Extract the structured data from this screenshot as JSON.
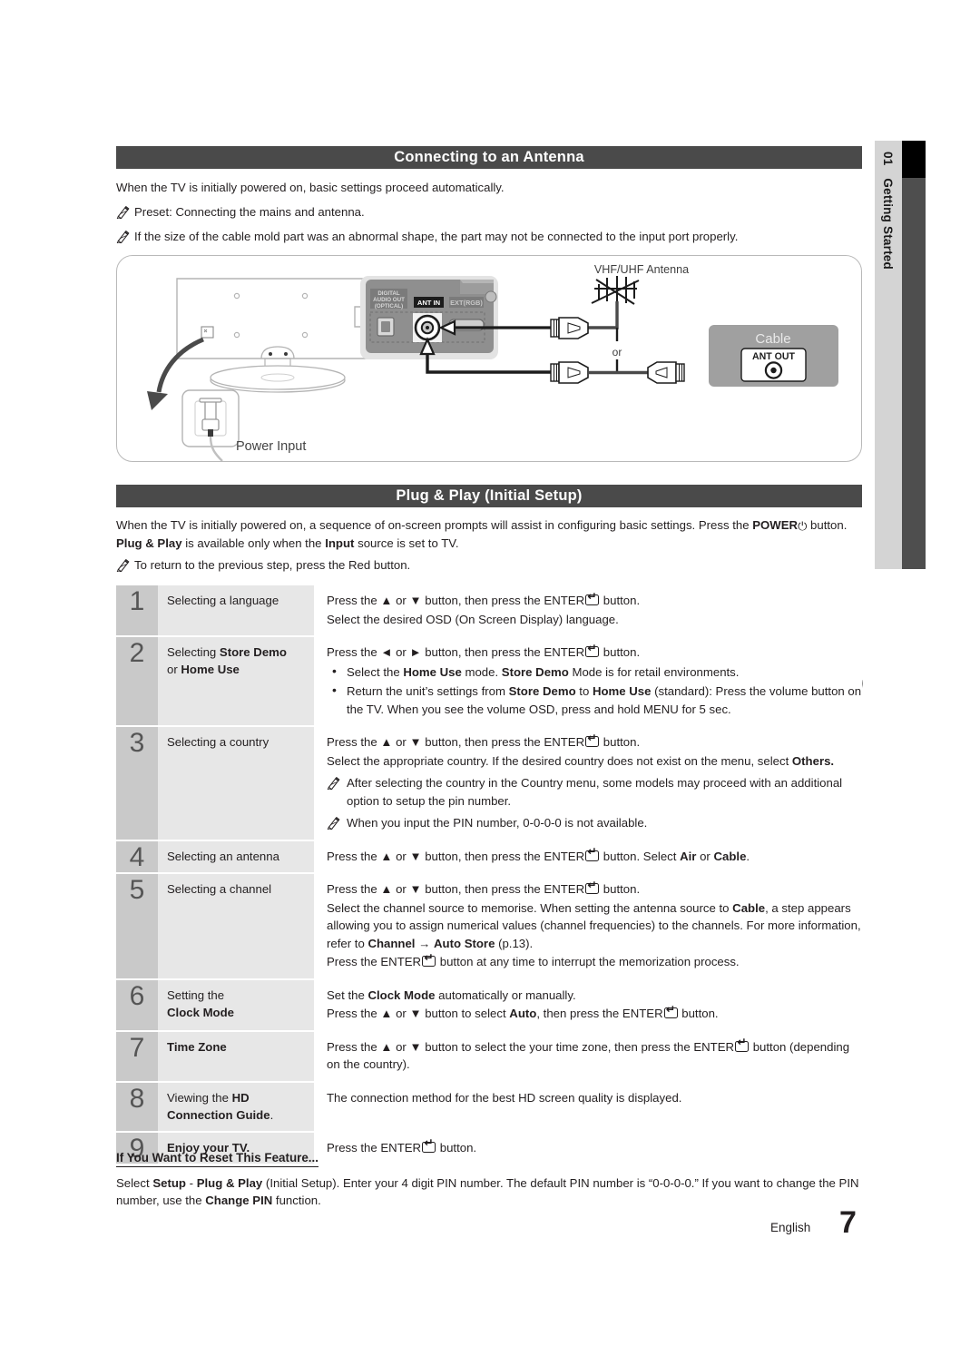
{
  "side_tab": {
    "number": "01",
    "label": "Getting Started"
  },
  "sections": {
    "antenna": {
      "title": "Connecting to an Antenna",
      "intro": "When the TV is initially powered on, basic settings proceed automatically.",
      "notes": [
        "Preset: Connecting the mains and antenna.",
        "If the size of the cable mold part was an abnormal shape, the part may not be connected to the input port properly."
      ]
    },
    "plugplay": {
      "title": "Plug & Play (Initial Setup)",
      "intro_1": "When the TV is initially powered on, a sequence of on-screen prompts will assist in configuring basic settings. Press the",
      "intro_power": "POWER",
      "intro_2": "button.",
      "intro_bold_pp": "Plug & Play",
      "intro_3": "is available only when the",
      "intro_bold_input": "Input",
      "intro_4": "source is set to TV.",
      "note": "To return to the previous step, press the Red button.",
      "power_caption": "POWER"
    }
  },
  "diagram": {
    "power_input_label": "Power Input",
    "antenna_label": "VHF/UHF Antenna",
    "or_label": "or",
    "cable_box_label": "Cable",
    "ant_out_label": "ANT OUT",
    "ant_in_label": "ANT IN",
    "digital_audio_label": "DIGITAL\nAUDIO OUT\n(OPTICAL)",
    "digital_audio_l1": "DIGITAL",
    "digital_audio_l2": "AUDIO OUT",
    "digital_audio_l3": "(OPTICAL)",
    "ext_rgb_label": "EXT(RGB)"
  },
  "steps": [
    {
      "num": "1",
      "label_parts": [
        {
          "t": "Selecting a language",
          "b": false
        }
      ],
      "lines": [
        {
          "parts": [
            {
              "t": "Press the ▲ or ▼ button, then press the ENTER",
              "b": false
            },
            {
              "key": true
            },
            {
              "t": "button.",
              "b": false
            }
          ]
        },
        {
          "parts": [
            {
              "t": "Select the desired OSD (On Screen Display) language.",
              "b": false
            }
          ]
        }
      ],
      "bullets": [],
      "notes": []
    },
    {
      "num": "2",
      "label_parts": [
        {
          "t": "Selecting ",
          "b": false
        },
        {
          "t": "Store Demo",
          "b": true
        },
        {
          "br": true
        },
        {
          "t": "or ",
          "b": false
        },
        {
          "t": "Home Use",
          "b": true
        }
      ],
      "lines": [
        {
          "parts": [
            {
              "t": "Press the ◄ or ► button, then press the ENTER",
              "b": false
            },
            {
              "key": true
            },
            {
              "t": "button.",
              "b": false
            }
          ]
        }
      ],
      "bullets": [
        {
          "parts": [
            {
              "t": "Select the ",
              "b": false
            },
            {
              "t": "Home Use",
              "b": true
            },
            {
              "t": " mode. ",
              "b": false
            },
            {
              "t": "Store Demo",
              "b": true
            },
            {
              "t": " Mode is for retail environments.",
              "b": false
            }
          ]
        },
        {
          "parts": [
            {
              "t": "Return the unit’s settings from ",
              "b": false
            },
            {
              "t": "Store Demo",
              "b": true
            },
            {
              "t": " to ",
              "b": false
            },
            {
              "t": "Home Use",
              "b": true
            },
            {
              "t": " (standard): Press the volume button on the TV. When you see the volume OSD, press and hold ",
              "b": false
            },
            {
              "t": "MENU",
              "b": false
            },
            {
              "t": " for 5 sec.",
              "b": false
            }
          ]
        }
      ],
      "notes": []
    },
    {
      "num": "3",
      "label_parts": [
        {
          "t": "Selecting a country",
          "b": false
        }
      ],
      "lines": [
        {
          "parts": [
            {
              "t": "Press the ▲ or ▼ button, then press the ENTER",
              "b": false
            },
            {
              "key": true
            },
            {
              "t": "button.",
              "b": false
            }
          ]
        },
        {
          "parts": [
            {
              "t": "Select the appropriate country. If the desired country does not exist on the menu, select ",
              "b": false
            },
            {
              "t": "Others.",
              "b": true
            }
          ]
        }
      ],
      "bullets": [],
      "notes": [
        {
          "parts": [
            {
              "t": "After selecting the country in the Country menu, some models may proceed with an additional option to setup the pin number.",
              "b": false
            }
          ]
        },
        {
          "parts": [
            {
              "t": "When you input the PIN number, 0-0-0-0 is not available.",
              "b": false
            }
          ]
        }
      ]
    },
    {
      "num": "4",
      "label_parts": [
        {
          "t": "Selecting an antenna",
          "b": false
        }
      ],
      "lines": [
        {
          "parts": [
            {
              "t": "Press the ▲ or ▼ button, then press the ENTER",
              "b": false
            },
            {
              "key": true
            },
            {
              "t": "button. Select ",
              "b": false
            },
            {
              "t": "Air",
              "b": true
            },
            {
              "t": " or ",
              "b": false
            },
            {
              "t": "Cable",
              "b": true
            },
            {
              "t": ".",
              "b": false
            }
          ]
        }
      ],
      "bullets": [],
      "notes": []
    },
    {
      "num": "5",
      "label_parts": [
        {
          "t": "Selecting a channel",
          "b": false
        }
      ],
      "lines": [
        {
          "parts": [
            {
              "t": "Press the ▲ or ▼ button, then press the ENTER",
              "b": false
            },
            {
              "key": true
            },
            {
              "t": "button.",
              "b": false
            }
          ]
        },
        {
          "parts": [
            {
              "t": "Select the channel source to memorise. When setting the antenna source to ",
              "b": false
            },
            {
              "t": "Cable",
              "b": true
            },
            {
              "t": ", a step appears allowing you to assign numerical values (channel frequencies) to the channels. For more information, refer to ",
              "b": false
            },
            {
              "t": "Channel",
              "b": true
            },
            {
              "t": " → ",
              "b": false
            },
            {
              "t": "Auto Store",
              "b": true
            },
            {
              "t": " (p.13).",
              "b": false
            }
          ]
        },
        {
          "parts": [
            {
              "t": "Press the ENTER",
              "b": false
            },
            {
              "key": true
            },
            {
              "t": "button at any time to interrupt the memorization process.",
              "b": false
            }
          ]
        }
      ],
      "bullets": [],
      "notes": []
    },
    {
      "num": "6",
      "label_parts": [
        {
          "t": "Setting the",
          "b": false
        },
        {
          "br": true
        },
        {
          "t": "Clock Mode",
          "b": true
        }
      ],
      "lines": [
        {
          "parts": [
            {
              "t": "Set the ",
              "b": false
            },
            {
              "t": "Clock Mode",
              "b": true
            },
            {
              "t": " automatically or manually.",
              "b": false
            }
          ]
        },
        {
          "parts": [
            {
              "t": "Press the ▲ or ▼ button to select ",
              "b": false
            },
            {
              "t": "Auto",
              "b": true
            },
            {
              "t": ", then press the ENTER",
              "b": false
            },
            {
              "key": true
            },
            {
              "t": "button.",
              "b": false
            }
          ]
        }
      ],
      "bullets": [],
      "notes": []
    },
    {
      "num": "7",
      "label_parts": [
        {
          "t": "Time Zone",
          "b": true
        }
      ],
      "lines": [
        {
          "parts": [
            {
              "t": "Press the ▲ or ▼ button to select the your time zone, then press the ENTER",
              "b": false
            },
            {
              "key": true
            },
            {
              "t": "button (depending on the country).",
              "b": false
            }
          ]
        }
      ],
      "bullets": [],
      "notes": []
    },
    {
      "num": "8",
      "label_parts": [
        {
          "t": "Viewing the ",
          "b": false
        },
        {
          "t": "HD",
          "b": true
        },
        {
          "br": true
        },
        {
          "t": "Connection Guide",
          "b": true
        },
        {
          "t": ".",
          "b": false
        }
      ],
      "lines": [
        {
          "parts": [
            {
              "t": "The connection method for the best HD screen quality is displayed.",
              "b": false
            }
          ]
        }
      ],
      "bullets": [],
      "notes": []
    },
    {
      "num": "9",
      "label_parts": [
        {
          "t": "Enjoy your TV.",
          "b": true
        }
      ],
      "lines": [
        {
          "parts": [
            {
              "t": "Press the ENTER",
              "b": false
            },
            {
              "key": true
            },
            {
              "t": "button.",
              "b": false
            }
          ]
        }
      ],
      "bullets": [],
      "notes": []
    }
  ],
  "reset": {
    "heading": "If You Want to Reset This Feature...",
    "body_parts": [
      {
        "t": "Select ",
        "b": false
      },
      {
        "t": "Setup",
        "b": true
      },
      {
        "t": " - ",
        "b": false
      },
      {
        "t": "Plug & Play",
        "b": true
      },
      {
        "t": " (Initial Setup). Enter your 4 digit PIN number. The default PIN number is “0-0-0-0.” If you want to change the PIN number, use the ",
        "b": false
      },
      {
        "t": "Change PIN",
        "b": true
      },
      {
        "t": " function.",
        "b": false
      }
    ]
  },
  "footer": {
    "language": "English",
    "page": "7"
  },
  "colors": {
    "section_bar": "#4a4a4a",
    "tab_light": "#d4d4d4",
    "tab_dark": "#4e4e4e",
    "tab_black": "#000000",
    "num_cell": "#c9c9c9",
    "label_cell": "#e7e7e7",
    "text": "#231f20"
  }
}
